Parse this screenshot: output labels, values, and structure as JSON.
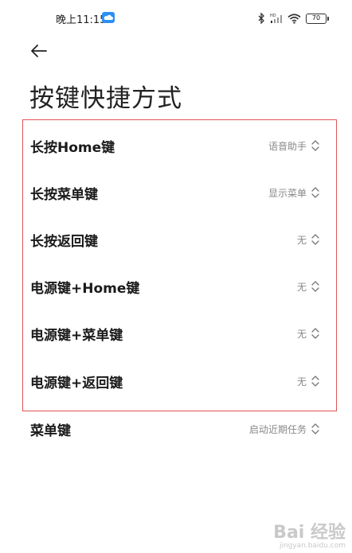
{
  "status_bar": {
    "time": "晚上11:15",
    "battery": "70"
  },
  "header": {
    "title": "按键快捷方式"
  },
  "settings": [
    {
      "label": "长按Home键",
      "value": "语音助手"
    },
    {
      "label": "长按菜单键",
      "value": "显示菜单"
    },
    {
      "label": "长按返回键",
      "value": "无"
    },
    {
      "label": "电源键+Home键",
      "value": "无"
    },
    {
      "label": "电源键+菜单键",
      "value": "无"
    },
    {
      "label": "电源键+返回键",
      "value": "无"
    },
    {
      "label": "菜单键",
      "value": "启动近期任务"
    }
  ],
  "watermark": {
    "logo": "Bai 经验",
    "url": "jingyan.baidu.com"
  },
  "colors": {
    "highlight_border": "#e05555",
    "cloud_icon": "#2f8ff0"
  }
}
